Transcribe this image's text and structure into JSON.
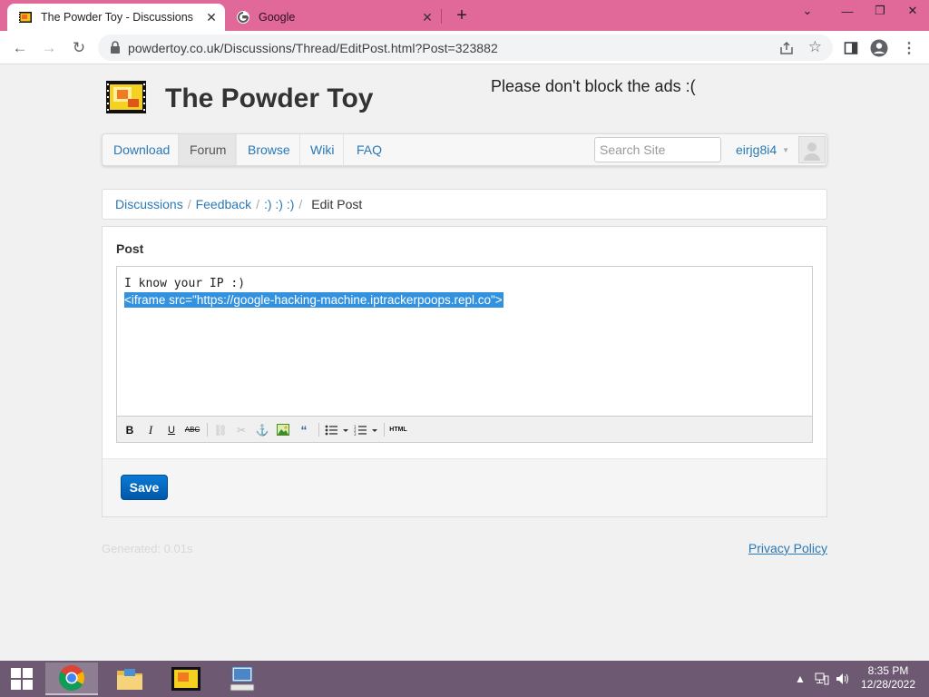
{
  "browser": {
    "tabs": [
      {
        "title": "The Powder Toy - Discussions",
        "active": true
      },
      {
        "title": "Google",
        "active": false
      }
    ],
    "url": "powdertoy.co.uk/Discussions/Thread/EditPost.html?Post=323882"
  },
  "site": {
    "title": "The Powder Toy",
    "ads_message": "Please don't block the ads :(",
    "nav": {
      "items": [
        "Download",
        "Forum",
        "Browse",
        "Wiki",
        "FAQ"
      ],
      "active": "Forum",
      "search_placeholder": "Search Site",
      "username": "eirjg8i4"
    },
    "breadcrumb": {
      "items": [
        "Discussions",
        "Feedback",
        ":) :) :)"
      ],
      "current": "Edit Post"
    },
    "editor": {
      "label": "Post",
      "line1": "I know your IP :)",
      "line2_selected": "<iframe src=\"https://google-hacking-machine.iptrackerpoops.repl.co\">",
      "toolbar": [
        "bold",
        "italic",
        "underline",
        "strikethrough",
        "link",
        "unlink",
        "anchor",
        "image",
        "quote",
        "bullet-list",
        "numbered-list",
        "html"
      ]
    },
    "save_label": "Save",
    "generated": "Generated: 0.01s",
    "privacy_policy": "Privacy Policy"
  },
  "taskbar": {
    "time": "8:35 PM",
    "date": "12/28/2022"
  },
  "colors": {
    "chrome_frame": "#e0699a",
    "link": "#2a78b5",
    "selection": "#3392e0",
    "save_button": "#0a6ac4",
    "taskbar": "#6d5a72"
  }
}
